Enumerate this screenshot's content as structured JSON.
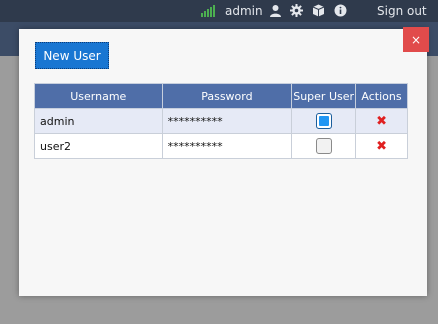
{
  "topbar": {
    "username": "admin",
    "sign_out_label": "Sign out",
    "icons": [
      "signal-icon",
      "user-icon",
      "gear-icon",
      "box-icon",
      "info-icon"
    ]
  },
  "modal": {
    "close_label": "×",
    "new_user_label": "New User",
    "table": {
      "headers": [
        "Username",
        "Password",
        "Super User",
        "Actions"
      ],
      "rows": [
        {
          "username": "admin",
          "password": "**********",
          "super_user": true,
          "action": "✖"
        },
        {
          "username": "user2",
          "password": "**********",
          "super_user": false,
          "action": "✖"
        }
      ]
    }
  },
  "colors": {
    "topbar": "#2f3a4c",
    "header": "#4f6ea8",
    "accent": "#1976d2",
    "close": "#e14b4b",
    "delete": "#e02020"
  }
}
